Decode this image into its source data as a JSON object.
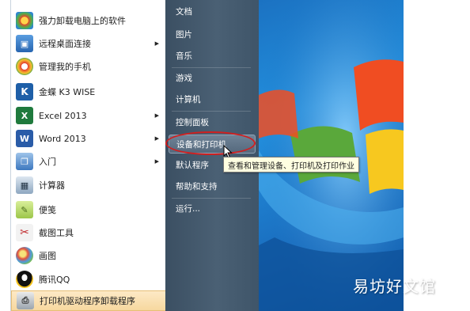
{
  "programs": [
    {
      "label": "强力卸载电脑上的软件",
      "icon": "flower-app-icon",
      "submenu": false
    },
    {
      "label": "远程桌面连接",
      "icon": "remote-desktop-icon",
      "submenu": true
    },
    {
      "label": "管理我的手机",
      "icon": "phone-manager-icon",
      "submenu": false
    },
    {
      "label": "金蝶 K3 WISE",
      "icon": "kingdee-k3-icon",
      "submenu": false
    },
    {
      "label": "Excel 2013",
      "icon": "excel-icon",
      "submenu": true
    },
    {
      "label": "Word 2013",
      "icon": "word-icon",
      "submenu": true
    },
    {
      "label": "入门",
      "icon": "getting-started-icon",
      "submenu": true
    },
    {
      "label": "计算器",
      "icon": "calculator-icon",
      "submenu": false
    },
    {
      "label": "便笺",
      "icon": "sticky-notes-icon",
      "submenu": false
    },
    {
      "label": "截图工具",
      "icon": "snipping-tool-icon",
      "submenu": false
    },
    {
      "label": "画图",
      "icon": "paint-icon",
      "submenu": false
    },
    {
      "label": "腾讯QQ",
      "icon": "qq-icon",
      "submenu": false
    },
    {
      "label": "打印机驱动程序卸载程序",
      "icon": "printer-uninstall-icon",
      "submenu": false
    }
  ],
  "links": [
    {
      "label": "文档"
    },
    {
      "label": "图片"
    },
    {
      "label": "音乐"
    },
    {
      "label": "游戏"
    },
    {
      "label": "计算机"
    },
    {
      "label": "控制面板"
    },
    {
      "label": "设备和打印机"
    },
    {
      "label": "默认程序"
    },
    {
      "label": "帮助和支持"
    },
    {
      "label": "运行..."
    }
  ],
  "tooltip": "查看和管理设备、打印机及打印作业",
  "watermark": "易坊好文馆",
  "colors": {
    "highlight_oval": "#d01f1f",
    "selected_item": "#f7d89f",
    "panel_dark": "#4a6074",
    "desktop_blue": "#1b72c2"
  }
}
